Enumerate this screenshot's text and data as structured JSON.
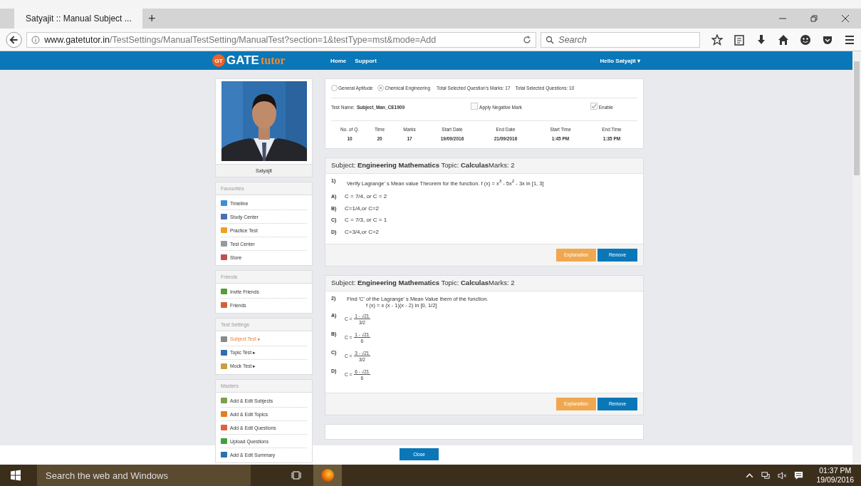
{
  "browser": {
    "tab_title": "Satyajit :: Manual Subject ...",
    "new_tab": "+",
    "url_host": "www.gatetutor.in",
    "url_path": "/TestSettings/ManualTestSetting/ManualTest?section=1&testType=mst&mode=Add",
    "search_placeholder": "Search"
  },
  "header": {
    "logo_badge": "GT",
    "logo_main": "GATE",
    "logo_accent": "tutor",
    "nav": [
      "Home",
      "Support"
    ],
    "user": "Hello Satyajit",
    "user_caret": "▾"
  },
  "profile": {
    "name": "Satyajit"
  },
  "sidebar": [
    {
      "title": "Favourites",
      "items": [
        {
          "label": "Timeline",
          "selected": false,
          "color": "#3b8fd6"
        },
        {
          "label": "Study Center",
          "selected": false,
          "color": "#4a6fb5"
        },
        {
          "label": "Practice Test",
          "selected": false,
          "color": "#f0a020"
        },
        {
          "label": "Test Center",
          "selected": false,
          "color": "#9a9a9a"
        },
        {
          "label": "Store",
          "selected": false,
          "color": "#c0504d"
        }
      ]
    },
    {
      "title": "Friends",
      "items": [
        {
          "label": "Invite Friends",
          "selected": false,
          "color": "#5a9a3a"
        },
        {
          "label": "Friends",
          "selected": false,
          "color": "#d0603a"
        }
      ]
    },
    {
      "title": "Test Settings",
      "items": [
        {
          "label": "Subject Test ▸",
          "selected": true,
          "color": "#8a8a8a"
        },
        {
          "label": "Topic Test ▸",
          "selected": false,
          "color": "#2d6fb0"
        },
        {
          "label": "Mock Test ▸",
          "selected": false,
          "color": "#c8a040"
        }
      ]
    },
    {
      "title": "Masters",
      "items": [
        {
          "label": "Add & Edit Subjects",
          "selected": false,
          "color": "#7aa04a"
        },
        {
          "label": "Add & Edit Topics",
          "selected": false,
          "color": "#e08020"
        },
        {
          "label": "Add & Edit Questions",
          "selected": false,
          "color": "#e06040"
        },
        {
          "label": "Upload Questions",
          "selected": false,
          "color": "#40a040"
        },
        {
          "label": "Add & Edit Summary",
          "selected": false,
          "color": "#2d6fb0"
        }
      ]
    }
  ],
  "settings": {
    "radios": [
      {
        "label": "General Aptitude",
        "selected": false
      },
      {
        "label": "Chemical Engineering",
        "selected": true
      }
    ],
    "summary": [
      "Total Selected Question's Marks: 17",
      "Total Selected Questions: 10"
    ],
    "test_name_label": "Test Name:",
    "test_name": "Subject_Man_CE1909",
    "checkboxes": [
      {
        "label": "Apply Negative Mark",
        "checked": false
      },
      {
        "label": "Enable",
        "checked": true
      }
    ],
    "stats": [
      {
        "label": "No. of Q.",
        "value": "10"
      },
      {
        "label": "Time",
        "value": "20"
      },
      {
        "label": "Marks",
        "value": "17"
      },
      {
        "label": "Start Date",
        "value": "19/09/2016"
      },
      {
        "label": "End Date",
        "value": "21/09/2016"
      },
      {
        "label": "Start Time",
        "value": "1:45 PM"
      },
      {
        "label": "End Time",
        "value": "1:35 PM"
      }
    ]
  },
  "questions": [
    {
      "header": "Subject: **Engineering Mathematics** Topic: **Calculas**Marks: 2",
      "number": "1)",
      "lines": [
        "Verify Lagrange' s  Mean value  Theorem for the function. f (x) = x$^{3}$ - 5x$^{2}$ - 3x in [1, 3]"
      ],
      "options": [
        {
          "letter": "A)",
          "kind": "text",
          "text": "C = 7/4, or C = 2"
        },
        {
          "letter": "B)",
          "kind": "text",
          "text": "C=1/4,or C=2"
        },
        {
          "letter": "C)",
          "kind": "text",
          "text": "C = 7/3, or C = 1"
        },
        {
          "letter": "D)",
          "kind": "text",
          "text": "C=3/4,or C=2"
        }
      ],
      "buttons": [
        "Explanation",
        "Remove"
      ]
    },
    {
      "header": "Subject: **Engineering Mathematics** Topic: **Calculas**Marks: 2",
      "number": "2)",
      "lines": [
        "Find  'C' of the Lagrange' s Mean Value them of the function.",
        "f (x) = x (x - 1)(x - 2) in [0, 1/2]"
      ],
      "options": [
        {
          "letter": "A)",
          "kind": "fraction",
          "lhs": "C =",
          "num": "1 - √21",
          "den": "3/2"
        },
        {
          "letter": "B)",
          "kind": "fraction",
          "lhs": "C =",
          "num": "1 - √21",
          "den": "6"
        },
        {
          "letter": "C)",
          "kind": "fraction",
          "lhs": "C =",
          "num": "3 - √21",
          "den": "3/2"
        },
        {
          "letter": "D)",
          "kind": "fraction",
          "lhs": "C =",
          "num": "6 - √21",
          "den": "6"
        }
      ],
      "buttons": [
        "Explanation",
        "Remove"
      ]
    }
  ],
  "footer": {
    "button": "Close"
  },
  "taskbar": {
    "search": "Search the web and Windows",
    "time": "01:37 PM",
    "date": "19/09/2016"
  }
}
